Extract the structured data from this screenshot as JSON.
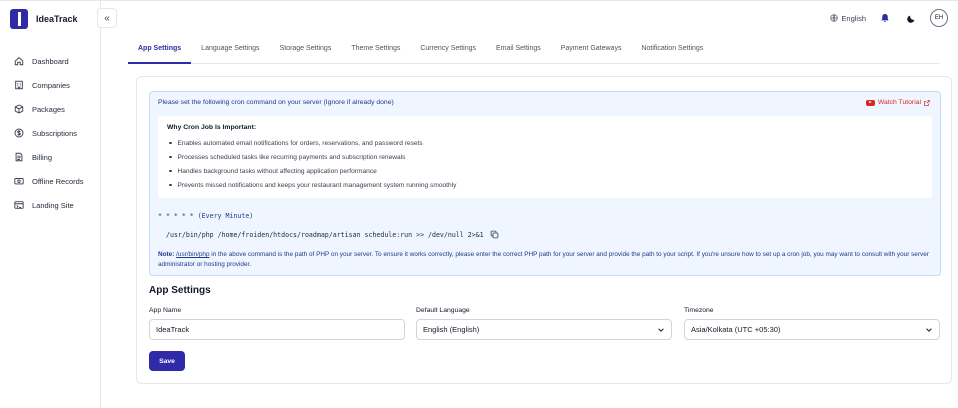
{
  "app": {
    "name": "IdeaTrack"
  },
  "sidebar": {
    "items": [
      {
        "label": "Dashboard",
        "icon": "home-icon"
      },
      {
        "label": "Companies",
        "icon": "building-icon"
      },
      {
        "label": "Packages",
        "icon": "box-icon"
      },
      {
        "label": "Subscriptions",
        "icon": "dollar-icon"
      },
      {
        "label": "Billing",
        "icon": "document-icon"
      },
      {
        "label": "Offline Records",
        "icon": "cash-icon"
      },
      {
        "label": "Landing Site",
        "icon": "browser-icon"
      }
    ]
  },
  "header": {
    "language": "English",
    "avatar_initials": "EH"
  },
  "tabs": [
    {
      "label": "App Settings",
      "active": true
    },
    {
      "label": "Language Settings"
    },
    {
      "label": "Storage Settings"
    },
    {
      "label": "Theme Settings"
    },
    {
      "label": "Currency Settings"
    },
    {
      "label": "Email Settings"
    },
    {
      "label": "Payment Gateways"
    },
    {
      "label": "Notification Settings"
    }
  ],
  "cron": {
    "heading": "Please set the following cron command on your server (Ignore if already done)",
    "watch_tutorial": "Watch Tutorial",
    "why_title": "Why Cron Job Is Important:",
    "reasons": [
      "Enables automated email notifications for orders, reservations, and password resets",
      "Processes scheduled tasks like recurring payments and subscription renewals",
      "Handles background tasks without affecting application performance",
      "Prevents missed notifications and keeps your restaurant management system running smoothly"
    ],
    "schedule": "* * * * * (Every Minute)",
    "command": "/usr/bin/php /home/froiden/htdocs/roadmap/artisan schedule:run >> /dev/null 2>&1",
    "note_label": "Note:",
    "note_path": "/usr/bin/php",
    "note_text": " in the above command is the path of PHP on your server. To ensure it works correctly, please enter the correct PHP path for your server and provide the path to your script. If you're unsure how to set up a cron job, you may want to consult with your server administrator or hosting provider."
  },
  "app_settings": {
    "title": "App Settings",
    "app_name_label": "App Name",
    "app_name_value": "IdeaTrack",
    "language_label": "Default Language",
    "language_value": "English (English)",
    "timezone_label": "Timezone",
    "timezone_value": "Asia/Kolkata (UTC +05:30)",
    "save_label": "Save"
  },
  "colors": {
    "brand": "#2f2ba8",
    "info_bg": "#eff6ff",
    "info_border": "#bfdbfe",
    "danger": "#dc2626"
  }
}
